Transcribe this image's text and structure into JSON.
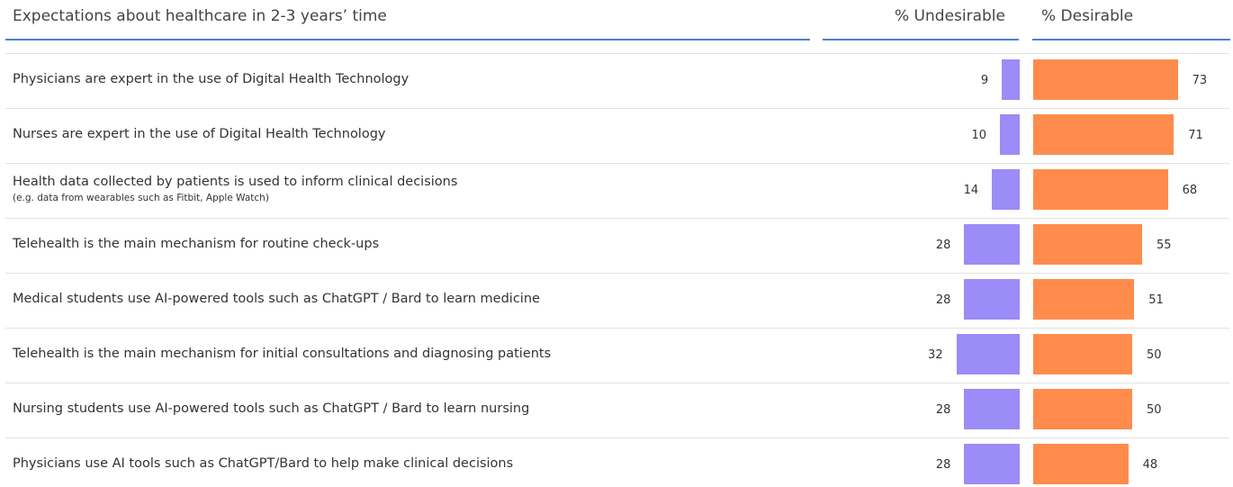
{
  "header": {
    "title": "Expectations about healthcare in 2-3 years’ time",
    "undesirable": "% Undesirable",
    "desirable": "% Desirable"
  },
  "colors": {
    "undesirable": "#9b8cf7",
    "desirable": "#ff8c4c",
    "rule": "#4a7fd6"
  },
  "chart_data": {
    "type": "bar",
    "title": "Expectations about healthcare in 2-3 years’ time",
    "categories": [
      "Physicians are expert in the use of Digital Health Technology",
      "Nurses are expert in the use of Digital Health Technology",
      "Health data collected by patients is used to inform clinical decisions",
      "Telehealth is the main mechanism for routine check-ups",
      "Medical students use AI-powered tools such as ChatGPT / Bard to learn medicine",
      "Telehealth is the main mechanism for initial consultations and diagnosing patients",
      "Nursing students use AI-powered tools such as ChatGPT / Bard to learn nursing",
      "Physicians use AI tools such as ChatGPT/Bard to help make clinical decisions"
    ],
    "subnotes": [
      "",
      "",
      "(e.g. data from wearables such as Fitbit, Apple Watch)",
      "",
      "",
      "",
      "",
      ""
    ],
    "series": [
      {
        "name": "% Undesirable",
        "values": [
          9,
          10,
          14,
          28,
          28,
          32,
          28,
          28
        ]
      },
      {
        "name": "% Desirable",
        "values": [
          73,
          71,
          68,
          55,
          51,
          50,
          50,
          48
        ]
      }
    ]
  }
}
